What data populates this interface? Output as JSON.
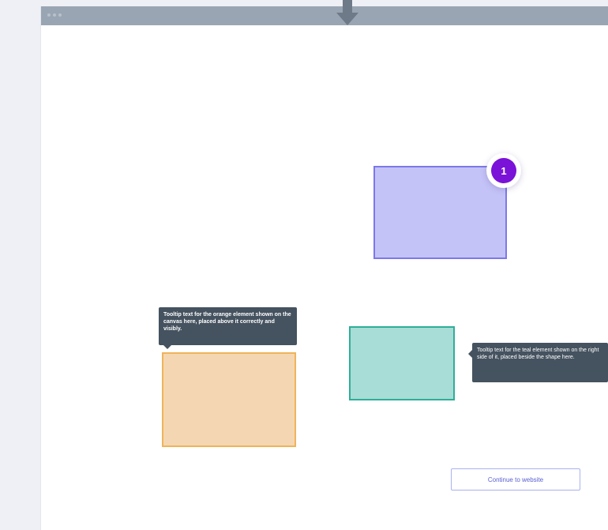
{
  "window": {
    "title_bar_color": "#9aa5b3",
    "pin_marker_icon": "pin-marker-icon"
  },
  "canvas": {
    "shapes": [
      {
        "name": "purple-rectangle",
        "fill": "#c4c3f7",
        "stroke": "#7c78ea"
      },
      {
        "name": "orange-rectangle",
        "fill": "#f4d7b2",
        "stroke": "#f0b35a"
      },
      {
        "name": "teal-rectangle",
        "fill": "#a7ddd6",
        "stroke": "#2eae98"
      }
    ],
    "step_badge": {
      "number": "1",
      "color": "#7a12d8"
    },
    "tooltips": {
      "left_text": "Tooltip text for the orange element shown on the canvas here, placed above it correctly and visibly.",
      "right_text": "Tooltip text for the teal element shown on the right side of it, placed beside the shape here."
    },
    "continue_button": {
      "label": "Continue to website"
    }
  },
  "colors": {
    "background": "#eef0f5",
    "tooltip_bg": "#45525f",
    "accent": "#5a5fd0"
  }
}
